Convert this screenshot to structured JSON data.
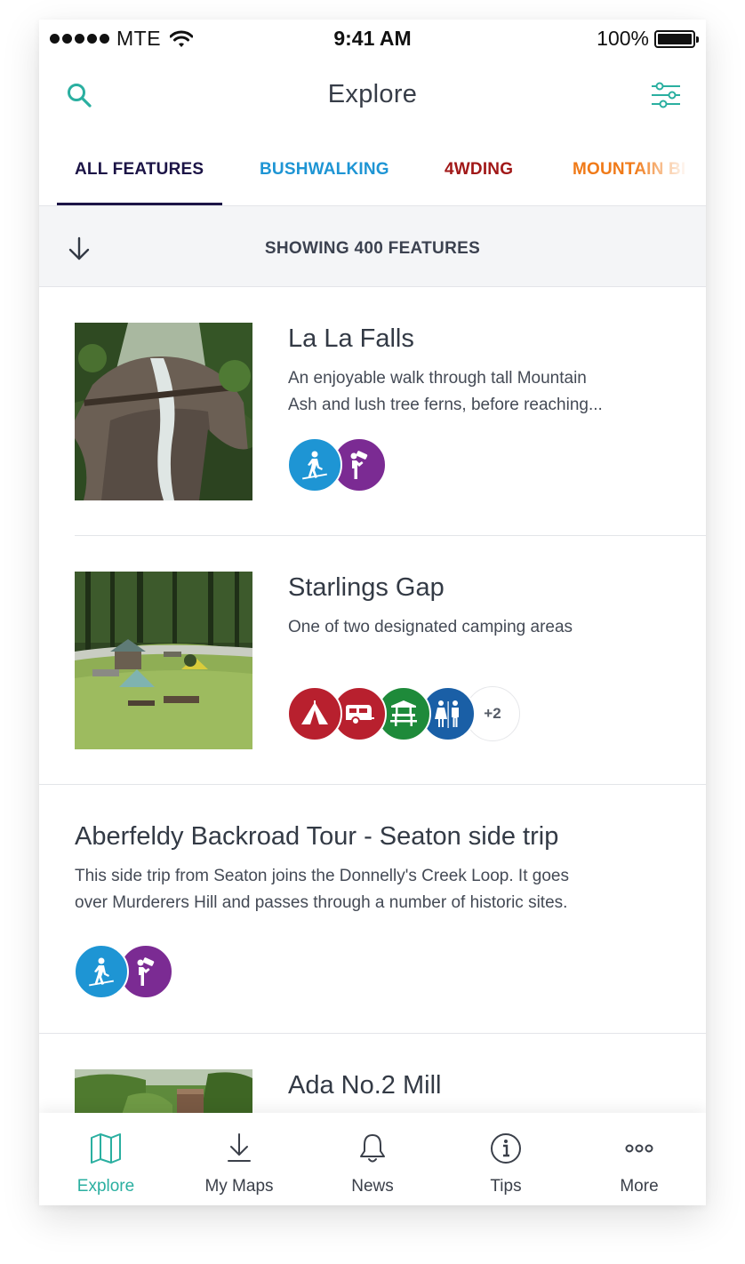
{
  "status_bar": {
    "carrier": "MTE",
    "time": "9:41 AM",
    "battery": "100%"
  },
  "header": {
    "title": "Explore",
    "search_icon": "search-icon",
    "filter_icon": "filter-sliders-icon"
  },
  "tabs": [
    {
      "label": "ALL FEATURES",
      "color": "#1c1446",
      "active": true
    },
    {
      "label": "BUSHWALKING",
      "color": "#1e95d4",
      "active": false
    },
    {
      "label": "4WDING",
      "color": "#a11818",
      "active": false
    },
    {
      "label": "MOUNTAIN BI",
      "color": "#f07a18",
      "active": false
    }
  ],
  "showing": {
    "text": "SHOWING 400 FEATURES",
    "sort_icon": "sort-arrow-down-icon"
  },
  "features": [
    {
      "title": "La La Falls",
      "description_lines": [
        "An enjoyable walk through tall Mountain",
        "Ash and lush tree ferns, before reaching..."
      ],
      "activities": [
        "bushwalking-icon",
        "lookout-icon"
      ]
    },
    {
      "title": "Starlings Gap",
      "description_lines": [
        "One of two designated camping areas"
      ],
      "activities": [
        "camping-icon",
        "caravan-icon",
        "picnic-icon",
        "toilets-icon"
      ],
      "more_count": "+2"
    },
    {
      "title": "Aberfeldy Backroad Tour - Seaton side trip",
      "description_lines": [
        "This side trip from Seaton joins the Donnelly's Creek Loop. It goes",
        "over Murderers Hill and passes through a number of historic sites."
      ],
      "activities": [
        "bushwalking-icon",
        "lookout-icon"
      ]
    },
    {
      "title": "Ada No.2 Mill"
    }
  ],
  "tab_bar": [
    {
      "label": "Explore",
      "icon": "map-icon",
      "active": true
    },
    {
      "label": "My Maps",
      "icon": "download-icon",
      "active": false
    },
    {
      "label": "News",
      "icon": "bell-icon",
      "active": false
    },
    {
      "label": "Tips",
      "icon": "info-icon",
      "active": false
    },
    {
      "label": "More",
      "icon": "more-dots-icon",
      "active": false
    }
  ],
  "colors": {
    "accent_teal": "#2aafa0",
    "bushwalking_blue": "#1e95d4",
    "lookout_purple": "#7b2b93",
    "camping_red": "#b8202e",
    "picnic_green": "#1e8a3a",
    "toilets_blue": "#1a5fa6"
  }
}
